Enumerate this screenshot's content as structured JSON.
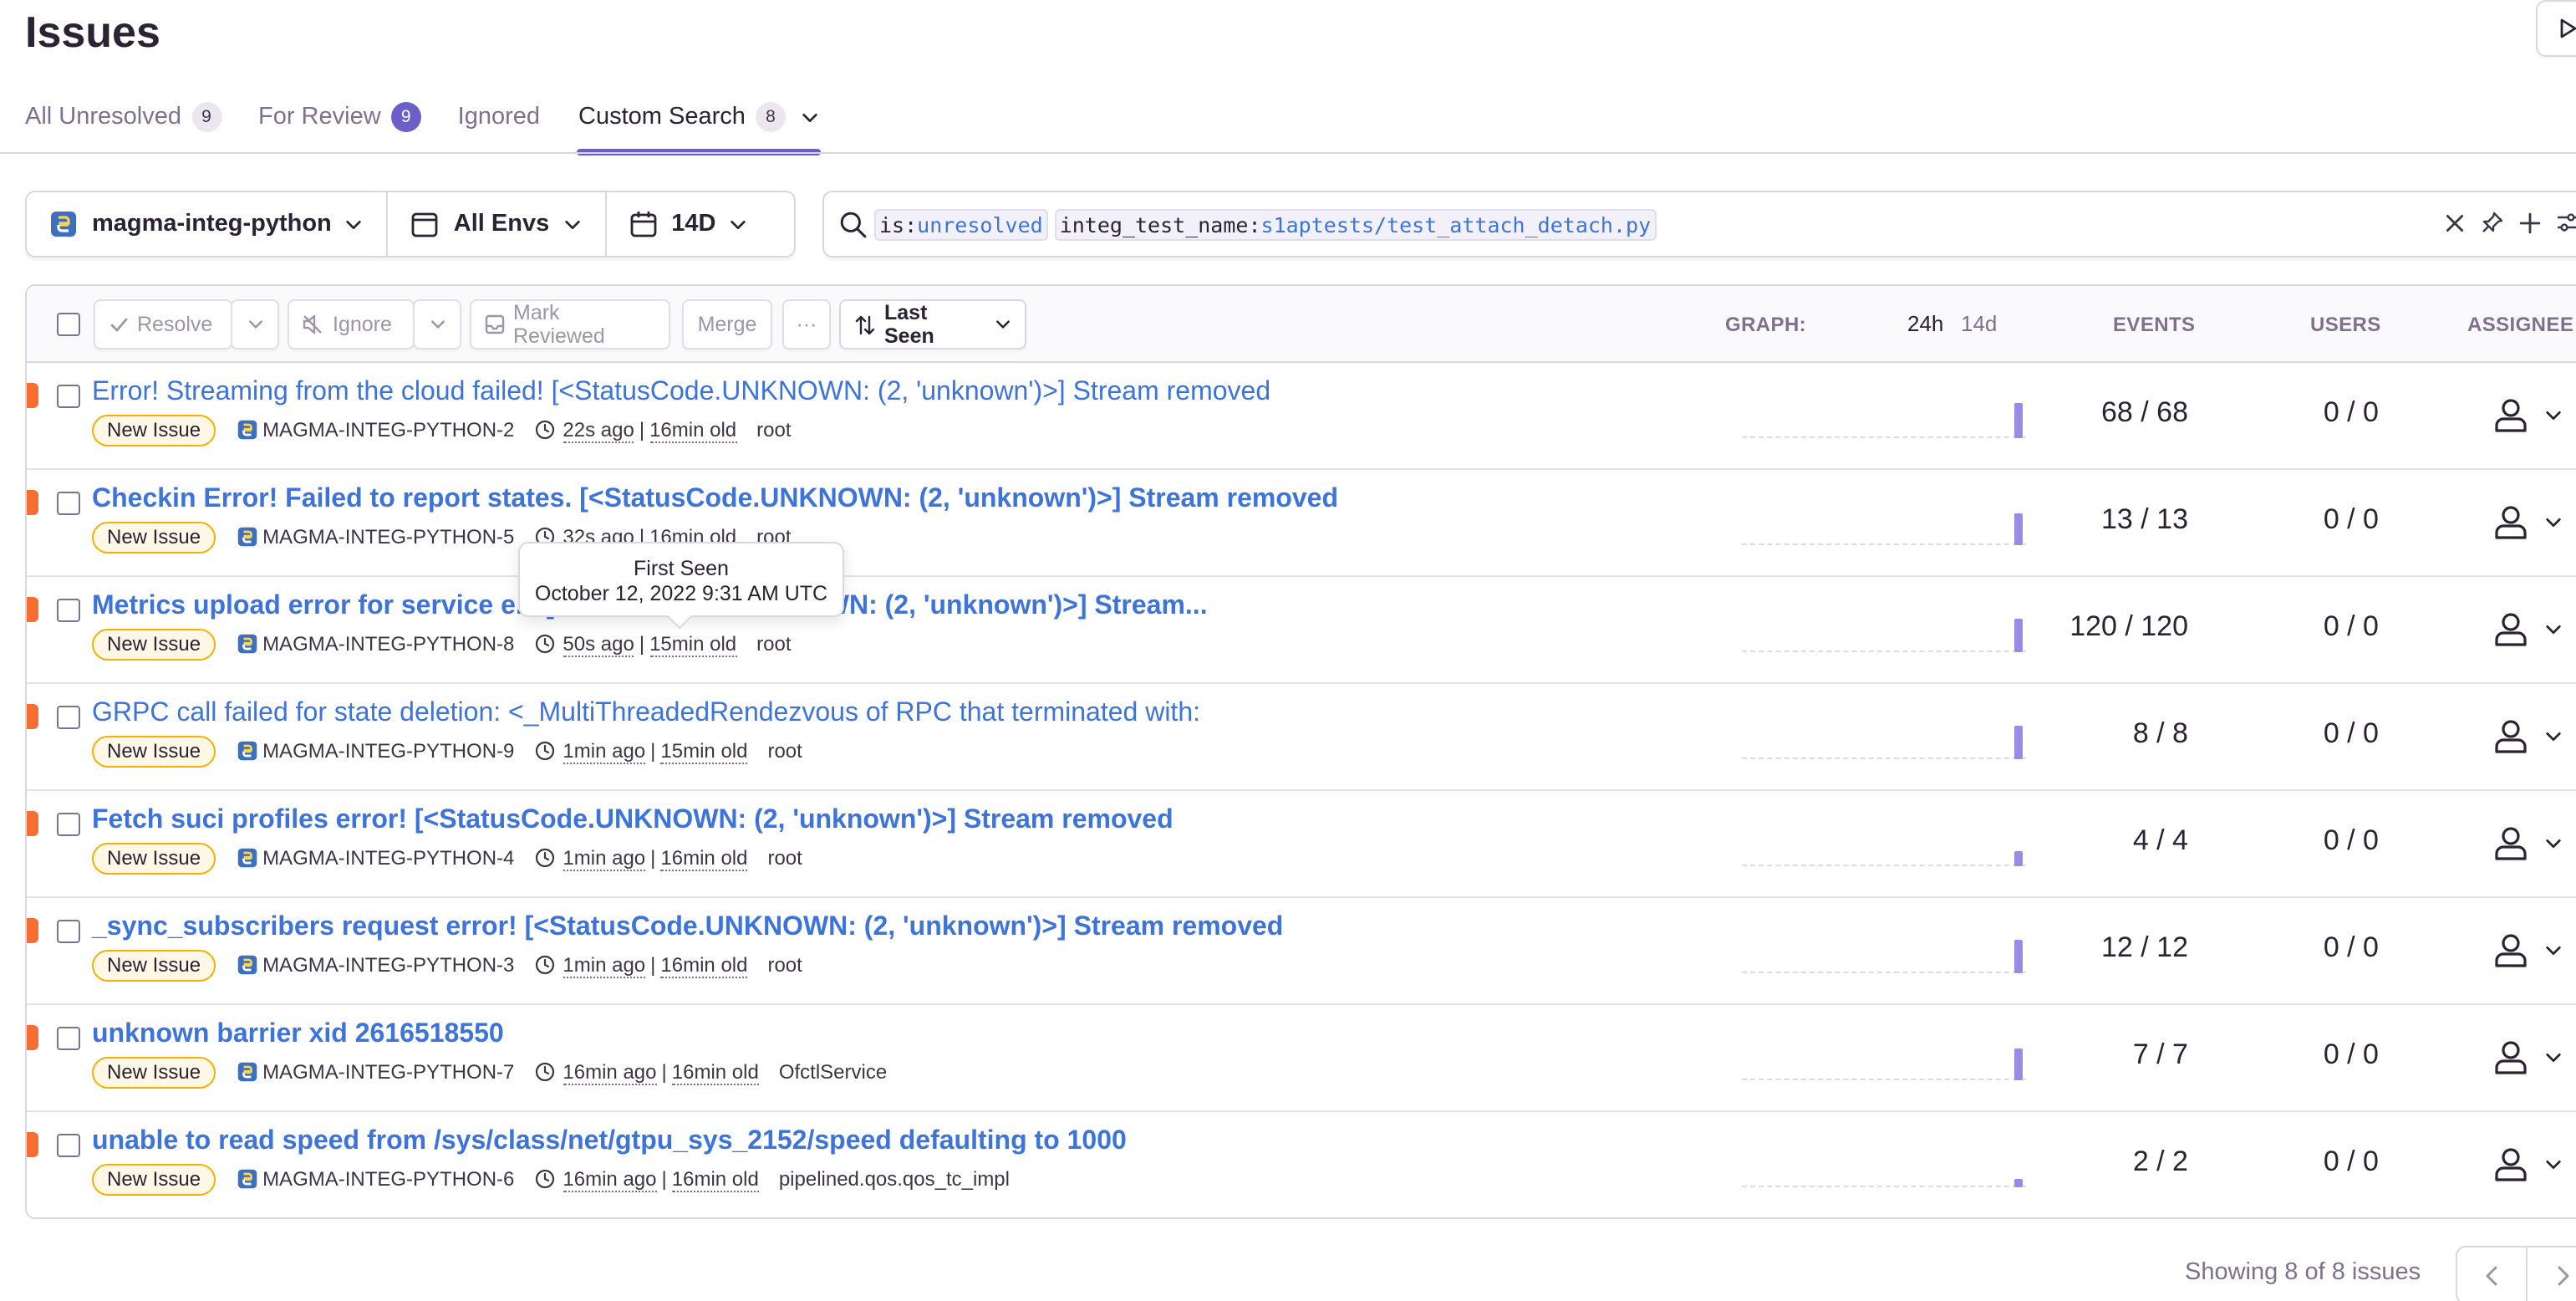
{
  "page": {
    "title": "Issues"
  },
  "tabs": [
    {
      "label": "All Unresolved",
      "count": "9"
    },
    {
      "label": "For Review",
      "count": "9"
    },
    {
      "label": "Ignored"
    },
    {
      "label": "Custom Search",
      "count": "8"
    }
  ],
  "filters": {
    "project": "magma-integ-python",
    "environment": "All Envs",
    "period": "14D"
  },
  "search": {
    "tokens": [
      {
        "key": "is:",
        "value": "unresolved"
      },
      {
        "key": "integ_test_name:",
        "value": "s1aptests/test_attach_detach.py"
      }
    ]
  },
  "actions": {
    "resolve": "Resolve",
    "ignore": "Ignore",
    "mark_reviewed": "Mark Reviewed",
    "merge": "Merge",
    "more": "···",
    "sort": "Last Seen"
  },
  "columns": {
    "graph": "GRAPH:",
    "graph_24h": "24h",
    "graph_14d": "14d",
    "events": "EVENTS",
    "users": "USERS",
    "assignee": "ASSIGNEE"
  },
  "issues": [
    {
      "title": "Error! Streaming from the cloud failed! [<StatusCode.UNKNOWN: (2, 'unknown')>] Stream removed",
      "badge": "New Issue",
      "project": "MAGMA-INTEG-PYTHON-2",
      "last_seen": "22s ago",
      "age": "16min old",
      "culprit": "root",
      "events": "68 / 68",
      "users": "0 / 0",
      "bar_level": 1.0
    },
    {
      "title": "Checkin Error! Failed to report states. [<StatusCode.UNKNOWN: (2, 'unknown')>] Stream removed",
      "badge": "New Issue",
      "project": "MAGMA-INTEG-PYTHON-5",
      "last_seen": "32s ago",
      "age": "16min old",
      "culprit": "root",
      "events": "13 / 13",
      "users": "0 / 0",
      "bar_level": 0.9
    },
    {
      "title": "Metrics upload error for service e... [<StatusCode.UNKNOWN: (2, 'unknown')>] Stream...",
      "badge": "New Issue",
      "project": "MAGMA-INTEG-PYTHON-8",
      "last_seen": "50s ago",
      "age": "15min old",
      "culprit": "root",
      "events": "120 / 120",
      "users": "0 / 0",
      "bar_level": 0.95
    },
    {
      "title": "GRPC call failed for state deletion: <_MultiThreadedRendezvous of RPC that terminated with:",
      "badge": "New Issue",
      "project": "MAGMA-INTEG-PYTHON-9",
      "last_seen": "1min ago",
      "age": "15min old",
      "culprit": "root",
      "events": "8 / 8",
      "users": "0 / 0",
      "bar_level": 0.95
    },
    {
      "title": "Fetch suci profiles error! [<StatusCode.UNKNOWN: (2, 'unknown')>] Stream removed",
      "badge": "New Issue",
      "project": "MAGMA-INTEG-PYTHON-4",
      "last_seen": "1min ago",
      "age": "16min old",
      "culprit": "root",
      "events": "4 / 4",
      "users": "0 / 0",
      "bar_level": 0.45
    },
    {
      "title": "_sync_subscribers request error! [<StatusCode.UNKNOWN: (2, 'unknown')>] Stream removed",
      "badge": "New Issue",
      "project": "MAGMA-INTEG-PYTHON-3",
      "last_seen": "1min ago",
      "age": "16min old",
      "culprit": "root",
      "events": "12 / 12",
      "users": "0 / 0",
      "bar_level": 0.95
    },
    {
      "title": "unknown barrier xid 2616518550",
      "badge": "New Issue",
      "project": "MAGMA-INTEG-PYTHON-7",
      "last_seen": "16min ago",
      "age": "16min old",
      "culprit": "OfctlService",
      "events": "7 / 7",
      "users": "0 / 0",
      "bar_level": 0.9
    },
    {
      "title": "unable to read speed from /sys/class/net/gtpu_sys_2152/speed defaulting to 1000",
      "badge": "New Issue",
      "project": "MAGMA-INTEG-PYTHON-6",
      "last_seen": "16min ago",
      "age": "16min old",
      "culprit": "pipelined.qos.qos_tc_impl",
      "events": "2 / 2",
      "users": "0 / 0",
      "bar_level": 0.25
    }
  ],
  "tooltip": {
    "title": "First Seen",
    "date": "October 12, 2022 9:31 AM UTC"
  },
  "footer": {
    "showing": "Showing 8 of 8 issues"
  },
  "colors": {
    "accent": "#6c5fc7",
    "link": "#3d74db",
    "level_error": "#f76e32",
    "graph_bar": "#9a8ce6",
    "badge_border": "#f5b000"
  }
}
